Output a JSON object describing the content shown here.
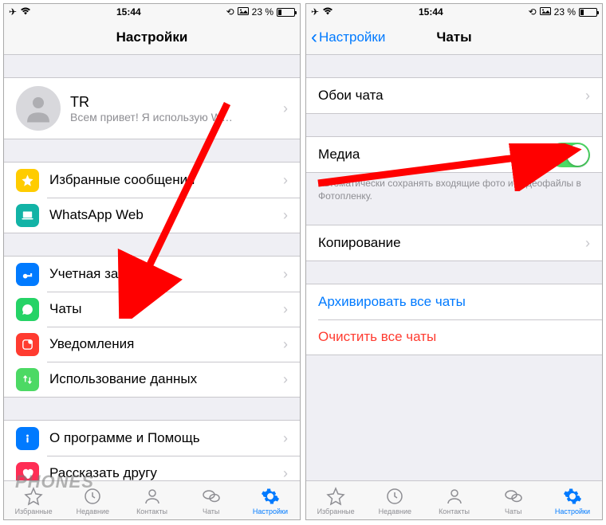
{
  "status": {
    "time": "15:44",
    "battery_text": "23 %"
  },
  "left": {
    "title": "Настройки",
    "profile": {
      "name": "TR",
      "status": "Всем привет! Я использую W…"
    },
    "group2": {
      "starred": "Избранные сообщения",
      "web": "WhatsApp Web"
    },
    "group3": {
      "account": "Учетная запись",
      "chats": "Чаты",
      "notifications": "Уведомления",
      "data": "Использование данных"
    },
    "group4": {
      "about": "О программе и Помощь",
      "tell": "Рассказать другу"
    }
  },
  "right": {
    "back": "Настройки",
    "title": "Чаты",
    "wallpaper": "Обои чата",
    "media": "Медиа",
    "media_footer": "Автоматически сохранять входящие фото и видеофайлы в Фотопленку.",
    "backup": "Копирование",
    "archive": "Архивировать все чаты",
    "clear": "Очистить все чаты"
  },
  "tabs": {
    "favorites": "Избранные",
    "recents": "Недавние",
    "contacts": "Контакты",
    "chats": "Чаты",
    "settings": "Настройки"
  },
  "watermark": "PHONES"
}
